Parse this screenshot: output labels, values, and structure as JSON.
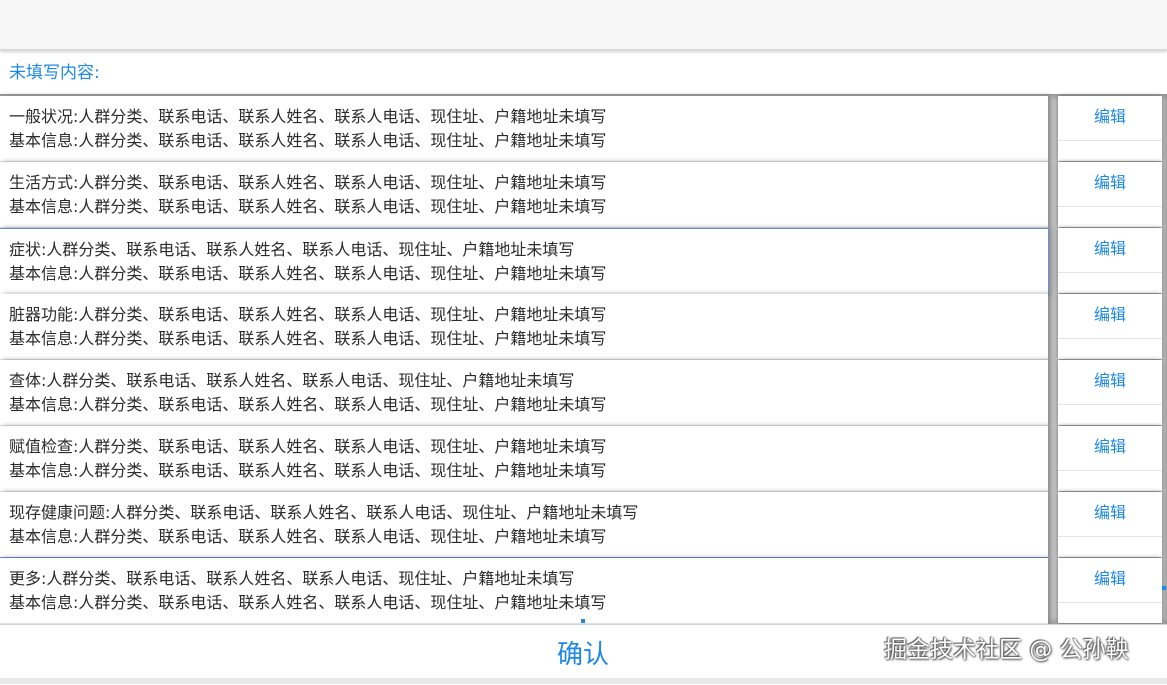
{
  "header": {
    "label": "未填写内容:"
  },
  "rows": [
    {
      "line1": "一般状况:人群分类、联系电话、联系人姓名、联系人电话、现住址、户籍地址未填写",
      "line2": "基本信息:人群分类、联系电话、联系人姓名、联系人电话、现住址、户籍地址未填写",
      "action": "编辑"
    },
    {
      "line1": "生活方式:人群分类、联系电话、联系人姓名、联系人电话、现住址、户籍地址未填写",
      "line2": "基本信息:人群分类、联系电话、联系人姓名、联系人电话、现住址、户籍地址未填写",
      "action": "编辑"
    },
    {
      "line1": "症状:人群分类、联系电话、联系人姓名、联系人电话、现住址、户籍地址未填写",
      "line2": "基本信息:人群分类、联系电话、联系人姓名、联系人电话、现住址、户籍地址未填写",
      "action": "编辑"
    },
    {
      "line1": "脏器功能:人群分类、联系电话、联系人姓名、联系人电话、现住址、户籍地址未填写",
      "line2": "基本信息:人群分类、联系电话、联系人姓名、联系人电话、现住址、户籍地址未填写",
      "action": "编辑"
    },
    {
      "line1": "查体:人群分类、联系电话、联系人姓名、联系人电话、现住址、户籍地址未填写",
      "line2": "基本信息:人群分类、联系电话、联系人姓名、联系人电话、现住址、户籍地址未填写",
      "action": "编辑"
    },
    {
      "line1": "赋值检查:人群分类、联系电话、联系人姓名、联系人电话、现住址、户籍地址未填写",
      "line2": "基本信息:人群分类、联系电话、联系人姓名、联系人电话、现住址、户籍地址未填写",
      "action": "编辑"
    },
    {
      "line1": "现存健康问题:人群分类、联系电话、联系人姓名、联系人电话、现住址、户籍地址未填写",
      "line2": "基本信息:人群分类、联系电话、联系人姓名、联系人电话、现住址、户籍地址未填写",
      "action": "编辑"
    },
    {
      "line1": "更多:人群分类、联系电话、联系人姓名、联系人电话、现住址、户籍地址未填写",
      "line2": "基本信息:人群分类、联系电话、联系人姓名、联系人电话、现住址、户籍地址未填写",
      "action": "编辑"
    }
  ],
  "footer": {
    "confirm_label": "确认",
    "watermark": "掘金技术社区 @ 公孙鞅"
  },
  "colors": {
    "accent": "#1e88e5",
    "text": "#2b2b2b",
    "highlight_border": "#6a8fd6"
  }
}
